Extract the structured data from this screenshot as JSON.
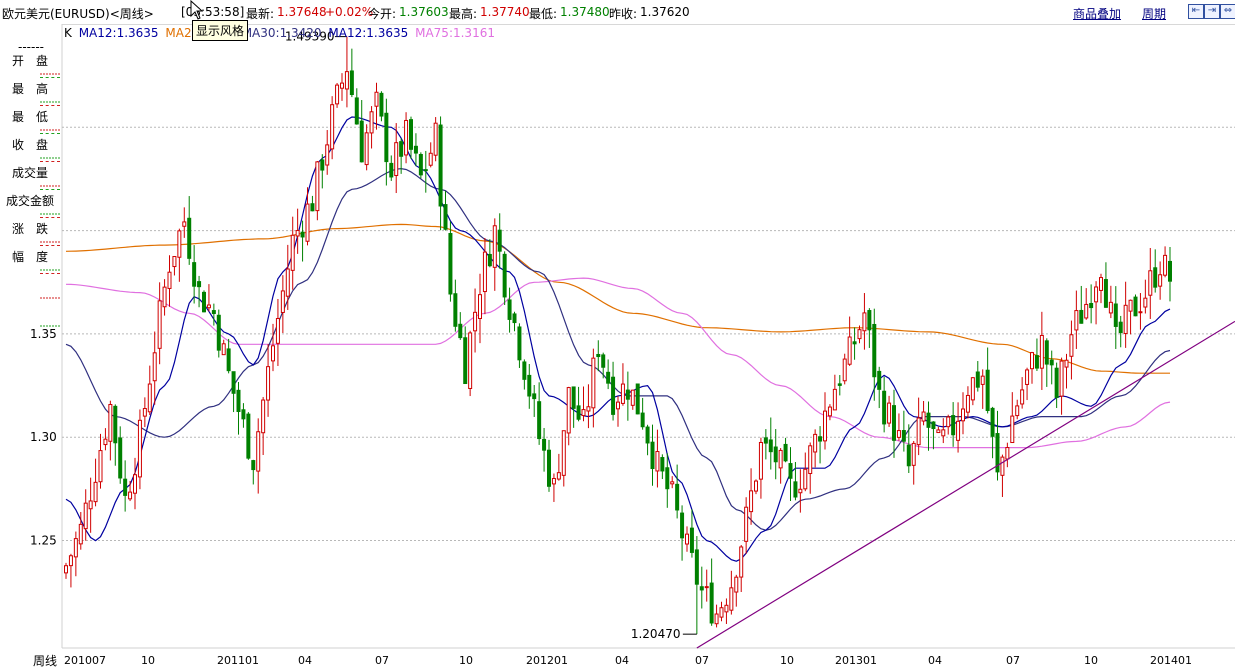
{
  "header": {
    "instrument": "欧元美元(EURUSD)<周线>",
    "time": "[03:53:58]",
    "last_label": "最新:",
    "last_value": "1.37648",
    "change": "+0.02%",
    "open_label": "今开:",
    "open_value": "1.37603",
    "high_label": "最高:",
    "high_value": "1.37740",
    "low_label": "最低:",
    "low_value": "1.37480",
    "prev_label": "昨收:",
    "prev_value": "1.37620",
    "overlay_link": "商品叠加",
    "period_link": "周期",
    "tooltip": "显示风格"
  },
  "legend": {
    "k": "K",
    "ma12a": "MA12:1.3635",
    "ma200": "MA200",
    "ma30": "MA30:1.3420",
    "ma12b": "MA12:1.3635",
    "ma75": "MA75:1.3161"
  },
  "sidebar": {
    "dash": "------",
    "items": [
      "开　盘",
      "最　高",
      "最　低",
      "收　盘",
      "成交量",
      "成交金额",
      "涨　跌",
      "幅　度"
    ]
  },
  "bottom_left": "周线",
  "colors": {
    "up": "#d00000",
    "down": "#008000",
    "ma12": "#0000a0",
    "ma30": "#303080",
    "ma75": "#e070e0",
    "ma200": "#e07000",
    "trend": "#800080",
    "grid": "#b8b8b8",
    "axis": "#d0d0d0"
  },
  "chart_data": {
    "type": "candlestick",
    "ylim": [
      1.198,
      1.5
    ],
    "yticks": [
      1.25,
      1.3,
      1.35
    ],
    "xticks": [
      "201007",
      "10",
      "201101",
      "04",
      "07",
      "10",
      "201201",
      "04",
      "07",
      "10",
      "201301",
      "04",
      "07",
      "10",
      "201401"
    ],
    "annotations": [
      {
        "label": "1.49390",
        "price": 1.4939
      },
      {
        "label": "1.20470",
        "price": 1.2047
      }
    ],
    "anchors": [
      [
        0,
        1.238
      ],
      [
        3,
        1.255
      ],
      [
        6,
        1.285
      ],
      [
        9,
        1.315
      ],
      [
        12,
        1.27
      ],
      [
        15,
        1.3
      ],
      [
        18,
        1.345
      ],
      [
        21,
        1.385
      ],
      [
        24,
        1.405
      ],
      [
        27,
        1.37
      ],
      [
        30,
        1.36
      ],
      [
        33,
        1.33
      ],
      [
        36,
        1.305
      ],
      [
        38,
        1.29
      ],
      [
        42,
        1.345
      ],
      [
        46,
        1.395
      ],
      [
        50,
        1.415
      ],
      [
        54,
        1.455
      ],
      [
        57,
        1.48
      ],
      [
        60,
        1.44
      ],
      [
        63,
        1.46
      ],
      [
        66,
        1.43
      ],
      [
        69,
        1.445
      ],
      [
        72,
        1.425
      ],
      [
        75,
        1.445
      ],
      [
        78,
        1.37
      ],
      [
        81,
        1.335
      ],
      [
        84,
        1.375
      ],
      [
        87,
        1.4
      ],
      [
        90,
        1.365
      ],
      [
        93,
        1.335
      ],
      [
        96,
        1.3
      ],
      [
        99,
        1.275
      ],
      [
        102,
        1.32
      ],
      [
        105,
        1.305
      ],
      [
        108,
        1.345
      ],
      [
        111,
        1.32
      ],
      [
        114,
        1.325
      ],
      [
        117,
        1.31
      ],
      [
        120,
        1.285
      ],
      [
        123,
        1.27
      ],
      [
        126,
        1.245
      ],
      [
        129,
        1.225
      ],
      [
        132,
        1.215
      ],
      [
        135,
        1.23
      ],
      [
        138,
        1.26
      ],
      [
        141,
        1.295
      ],
      [
        144,
        1.29
      ],
      [
        147,
        1.275
      ],
      [
        150,
        1.285
      ],
      [
        153,
        1.305
      ],
      [
        156,
        1.325
      ],
      [
        159,
        1.34
      ],
      [
        162,
        1.36
      ],
      [
        165,
        1.32
      ],
      [
        168,
        1.305
      ],
      [
        171,
        1.285
      ],
      [
        174,
        1.31
      ],
      [
        177,
        1.295
      ],
      [
        180,
        1.305
      ],
      [
        183,
        1.325
      ],
      [
        186,
        1.33
      ],
      [
        189,
        1.28
      ],
      [
        192,
        1.31
      ],
      [
        195,
        1.33
      ],
      [
        198,
        1.345
      ],
      [
        201,
        1.32
      ],
      [
        204,
        1.35
      ],
      [
        207,
        1.365
      ],
      [
        210,
        1.385
      ],
      [
        213,
        1.345
      ],
      [
        216,
        1.36
      ],
      [
        219,
        1.37
      ],
      [
        222,
        1.385
      ],
      [
        224,
        1.377
      ]
    ],
    "ma_anchors": {
      "ma12": [
        [
          0,
          1.27
        ],
        [
          6,
          1.25
        ],
        [
          12,
          1.275
        ],
        [
          20,
          1.325
        ],
        [
          26,
          1.368
        ],
        [
          33,
          1.35
        ],
        [
          38,
          1.335
        ],
        [
          44,
          1.38
        ],
        [
          52,
          1.435
        ],
        [
          58,
          1.455
        ],
        [
          66,
          1.45
        ],
        [
          72,
          1.43
        ],
        [
          80,
          1.4
        ],
        [
          90,
          1.38
        ],
        [
          98,
          1.32
        ],
        [
          106,
          1.31
        ],
        [
          112,
          1.32
        ],
        [
          118,
          1.325
        ],
        [
          124,
          1.28
        ],
        [
          130,
          1.25
        ],
        [
          136,
          1.24
        ],
        [
          142,
          1.255
        ],
        [
          148,
          1.285
        ],
        [
          154,
          1.285
        ],
        [
          160,
          1.305
        ],
        [
          166,
          1.33
        ],
        [
          172,
          1.31
        ],
        [
          178,
          1.305
        ],
        [
          184,
          1.31
        ],
        [
          190,
          1.305
        ],
        [
          196,
          1.31
        ],
        [
          202,
          1.32
        ],
        [
          208,
          1.315
        ],
        [
          214,
          1.335
        ],
        [
          220,
          1.355
        ],
        [
          224,
          1.362
        ]
      ],
      "ma30": [
        [
          0,
          1.345
        ],
        [
          10,
          1.31
        ],
        [
          20,
          1.3
        ],
        [
          30,
          1.315
        ],
        [
          38,
          1.335
        ],
        [
          48,
          1.375
        ],
        [
          58,
          1.42
        ],
        [
          68,
          1.43
        ],
        [
          76,
          1.42
        ],
        [
          86,
          1.395
        ],
        [
          96,
          1.38
        ],
        [
          106,
          1.335
        ],
        [
          114,
          1.32
        ],
        [
          122,
          1.32
        ],
        [
          130,
          1.29
        ],
        [
          136,
          1.265
        ],
        [
          142,
          1.255
        ],
        [
          150,
          1.27
        ],
        [
          158,
          1.275
        ],
        [
          166,
          1.29
        ],
        [
          174,
          1.31
        ],
        [
          182,
          1.31
        ],
        [
          190,
          1.305
        ],
        [
          198,
          1.31
        ],
        [
          206,
          1.31
        ],
        [
          214,
          1.32
        ],
        [
          224,
          1.342
        ]
      ],
      "ma75": [
        [
          0,
          1.374
        ],
        [
          15,
          1.37
        ],
        [
          25,
          1.36
        ],
        [
          35,
          1.345
        ],
        [
          45,
          1.345
        ],
        [
          55,
          1.345
        ],
        [
          65,
          1.345
        ],
        [
          75,
          1.345
        ],
        [
          85,
          1.36
        ],
        [
          95,
          1.375
        ],
        [
          105,
          1.377
        ],
        [
          115,
          1.372
        ],
        [
          125,
          1.36
        ],
        [
          135,
          1.34
        ],
        [
          145,
          1.325
        ],
        [
          155,
          1.31
        ],
        [
          165,
          1.3
        ],
        [
          175,
          1.295
        ],
        [
          185,
          1.295
        ],
        [
          195,
          1.295
        ],
        [
          205,
          1.298
        ],
        [
          215,
          1.305
        ],
        [
          224,
          1.317
        ]
      ],
      "ma200": [
        [
          0,
          1.39
        ],
        [
          20,
          1.393
        ],
        [
          40,
          1.396
        ],
        [
          55,
          1.401
        ],
        [
          68,
          1.403
        ],
        [
          75,
          1.402
        ],
        [
          85,
          1.395
        ],
        [
          100,
          1.375
        ],
        [
          115,
          1.36
        ],
        [
          130,
          1.353
        ],
        [
          145,
          1.351
        ],
        [
          160,
          1.353
        ],
        [
          175,
          1.351
        ],
        [
          190,
          1.345
        ],
        [
          200,
          1.338
        ],
        [
          210,
          1.332
        ],
        [
          218,
          1.331
        ],
        [
          224,
          1.331
        ]
      ]
    },
    "trendline": [
      [
        128,
        1.198
      ],
      [
        224,
        1.337
      ]
    ]
  }
}
